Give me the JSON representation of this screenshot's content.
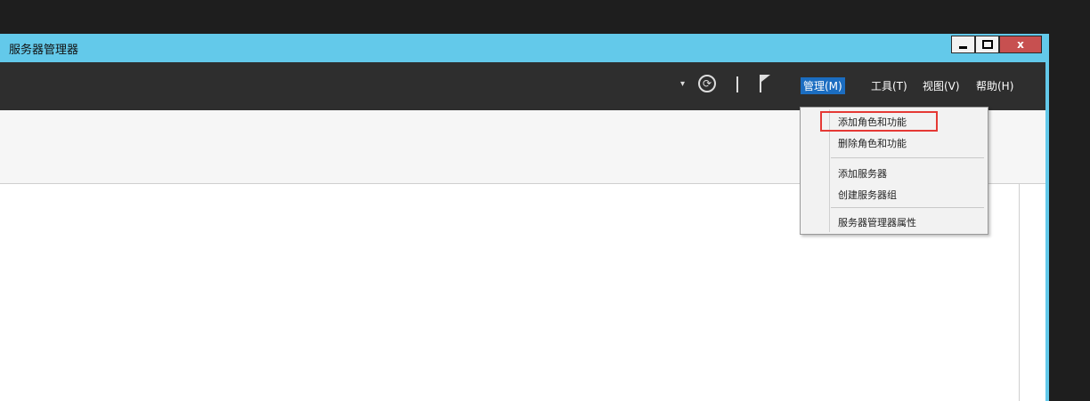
{
  "window": {
    "title": "服务器管理器",
    "close_label": "x"
  },
  "toolbar": {
    "refresh_glyph": "⟳",
    "dropdown_glyph": "▾",
    "menus": [
      {
        "label": "管理(M)",
        "active": true
      },
      {
        "label": "工具(T)"
      },
      {
        "label": "视图(V)"
      },
      {
        "label": "帮助(H)"
      }
    ]
  },
  "manage_menu": {
    "items": [
      {
        "label": "添加角色和功能",
        "highlighted": true
      },
      {
        "label": "删除角色和功能"
      },
      {
        "label": "添加服务器"
      },
      {
        "label": "创建服务器组"
      },
      {
        "label": "服务器管理器属性"
      }
    ]
  },
  "colors": {
    "title_bar": "#63c9ea",
    "toolbar": "#2e2e2e",
    "menu_active": "#1b6dc1",
    "highlight_border": "#e53935",
    "close_button": "#c75050"
  }
}
